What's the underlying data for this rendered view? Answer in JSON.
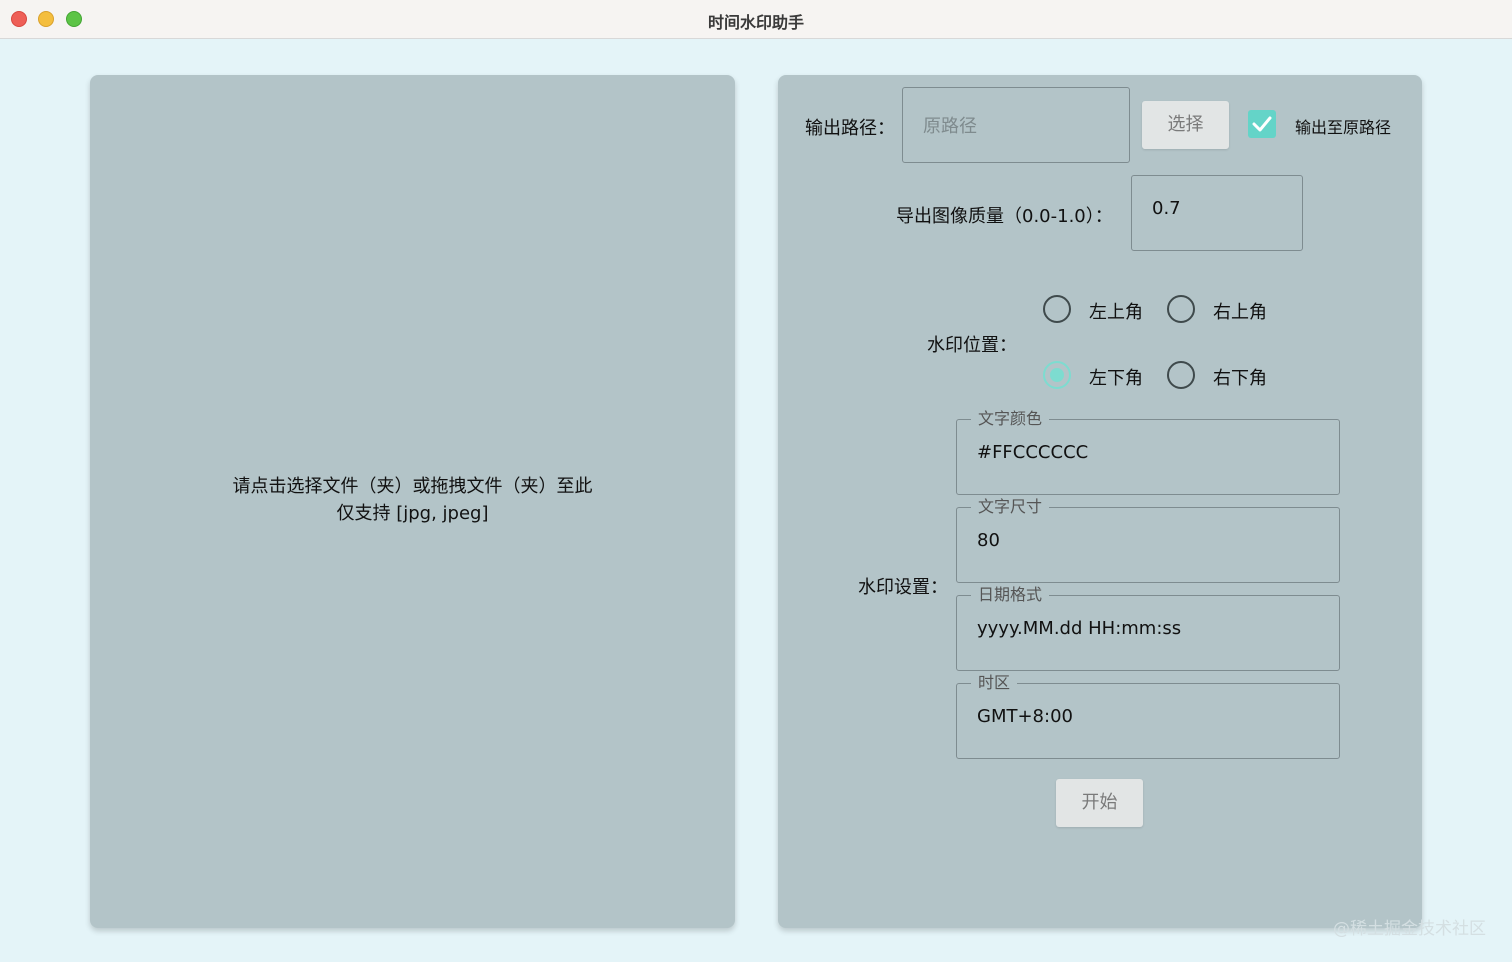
{
  "window": {
    "title": "时间水印助手"
  },
  "drop_area": {
    "line1": "请点击选择文件（夹）或拖拽文件（夹）至此",
    "line2": "仅支持 [jpg, jpeg]"
  },
  "output": {
    "label": "输出路径：",
    "placeholder": "原路径",
    "value": "",
    "choose_button": "选择",
    "checkbox_label": "输出至原路径",
    "checkbox_checked": true
  },
  "quality": {
    "label": "导出图像质量（0.0-1.0）：",
    "value": "0.7"
  },
  "position": {
    "label": "水印位置：",
    "options": [
      {
        "label": "左上角",
        "checked": false
      },
      {
        "label": "右上角",
        "checked": false
      },
      {
        "label": "左下角",
        "checked": true
      },
      {
        "label": "右下角",
        "checked": false
      }
    ]
  },
  "settings": {
    "label": "水印设置：",
    "color": {
      "legend": "文字颜色",
      "value": "#FFCCCCCC"
    },
    "size": {
      "legend": "文字尺寸",
      "value": "80"
    },
    "date_format": {
      "legend": "日期格式",
      "value": "yyyy.MM.dd HH:mm:ss"
    },
    "timezone": {
      "legend": "时区",
      "value": "GMT+8:00"
    }
  },
  "start_button": "开始",
  "watermark_text": "@稀土掘金技术社区",
  "colors": {
    "background": "#e4f4f8",
    "panel": "#b3c4c8",
    "accent": "#64d4c8"
  }
}
